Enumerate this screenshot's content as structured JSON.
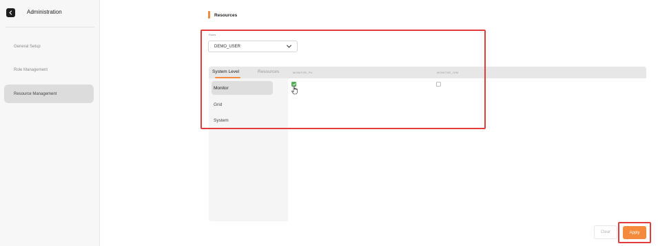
{
  "sidebar": {
    "title": "Administration",
    "items": [
      {
        "label": "General Setup",
        "active": false
      },
      {
        "label": "Role Management",
        "active": false
      },
      {
        "label": "Resource Management",
        "active": true
      }
    ]
  },
  "main": {
    "title": "Resources",
    "roles": {
      "label": "Roles",
      "selected": "DEMO_USER"
    },
    "tabs": [
      {
        "label": "System Level",
        "active": true
      },
      {
        "label": "Resources",
        "active": false
      }
    ],
    "columns": [
      "MONITOR_PU",
      "MONITOR_JVM"
    ],
    "list_items": [
      {
        "label": "Monitor",
        "active": true
      },
      {
        "label": "Grid",
        "active": false
      },
      {
        "label": "System",
        "active": false
      }
    ],
    "checkboxes": {
      "monitor_pu": true,
      "monitor_jvm": false
    },
    "buttons": {
      "clear": "Clear",
      "apply": "Apply"
    }
  },
  "colors": {
    "accent": "#f58a3c",
    "checked": "#4caf50",
    "highlight": "#e23b3b"
  },
  "icons": {
    "back": "chevron-left-icon",
    "dropdown": "chevron-down-icon",
    "checkmark": "check-icon",
    "cursor": "hand-pointer-icon"
  }
}
